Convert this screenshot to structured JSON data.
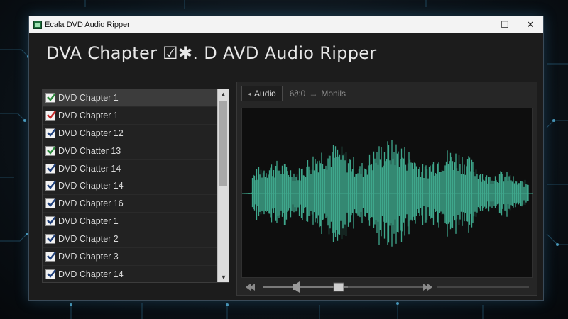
{
  "window": {
    "title": "Ecala DVD Audio Ripper",
    "heading": "DVA Chapter ☑✱. D AVD Audio Ripper",
    "minimize": "—",
    "maximize": "☐",
    "close": "✕"
  },
  "chapters": [
    {
      "label": "DVD Chapter 1",
      "checked": true,
      "selected": true
    },
    {
      "label": "DVD Chapter 1",
      "checked": true,
      "selected": false
    },
    {
      "label": "DVD Chapter 12",
      "checked": true,
      "selected": false
    },
    {
      "label": "DVD Chatter 13",
      "checked": true,
      "selected": false
    },
    {
      "label": "DVD Chatter 14",
      "checked": true,
      "selected": false
    },
    {
      "label": "DVD Chapter 14",
      "checked": true,
      "selected": false
    },
    {
      "label": "DVD Chapter 16",
      "checked": true,
      "selected": false
    },
    {
      "label": "DVD Chapter 1",
      "checked": true,
      "selected": false
    },
    {
      "label": "DVD Chapter 2",
      "checked": true,
      "selected": false
    },
    {
      "label": "DVD Chapter 3",
      "checked": true,
      "selected": false
    },
    {
      "label": "DVD Chapter 14",
      "checked": true,
      "selected": false
    }
  ],
  "toolbar": {
    "audio_tab": "Audio",
    "time": "6∂:0",
    "mode": "Monils"
  },
  "colors": {
    "waveform": "#3fa78c",
    "check_green": "#2e8b3e",
    "check_red": "#c62828",
    "check_blue": "#1f3f7a"
  },
  "icons": {
    "rewind": "rewind-icon",
    "volume": "volume-icon",
    "fast_forward": "fast-forward-icon"
  }
}
